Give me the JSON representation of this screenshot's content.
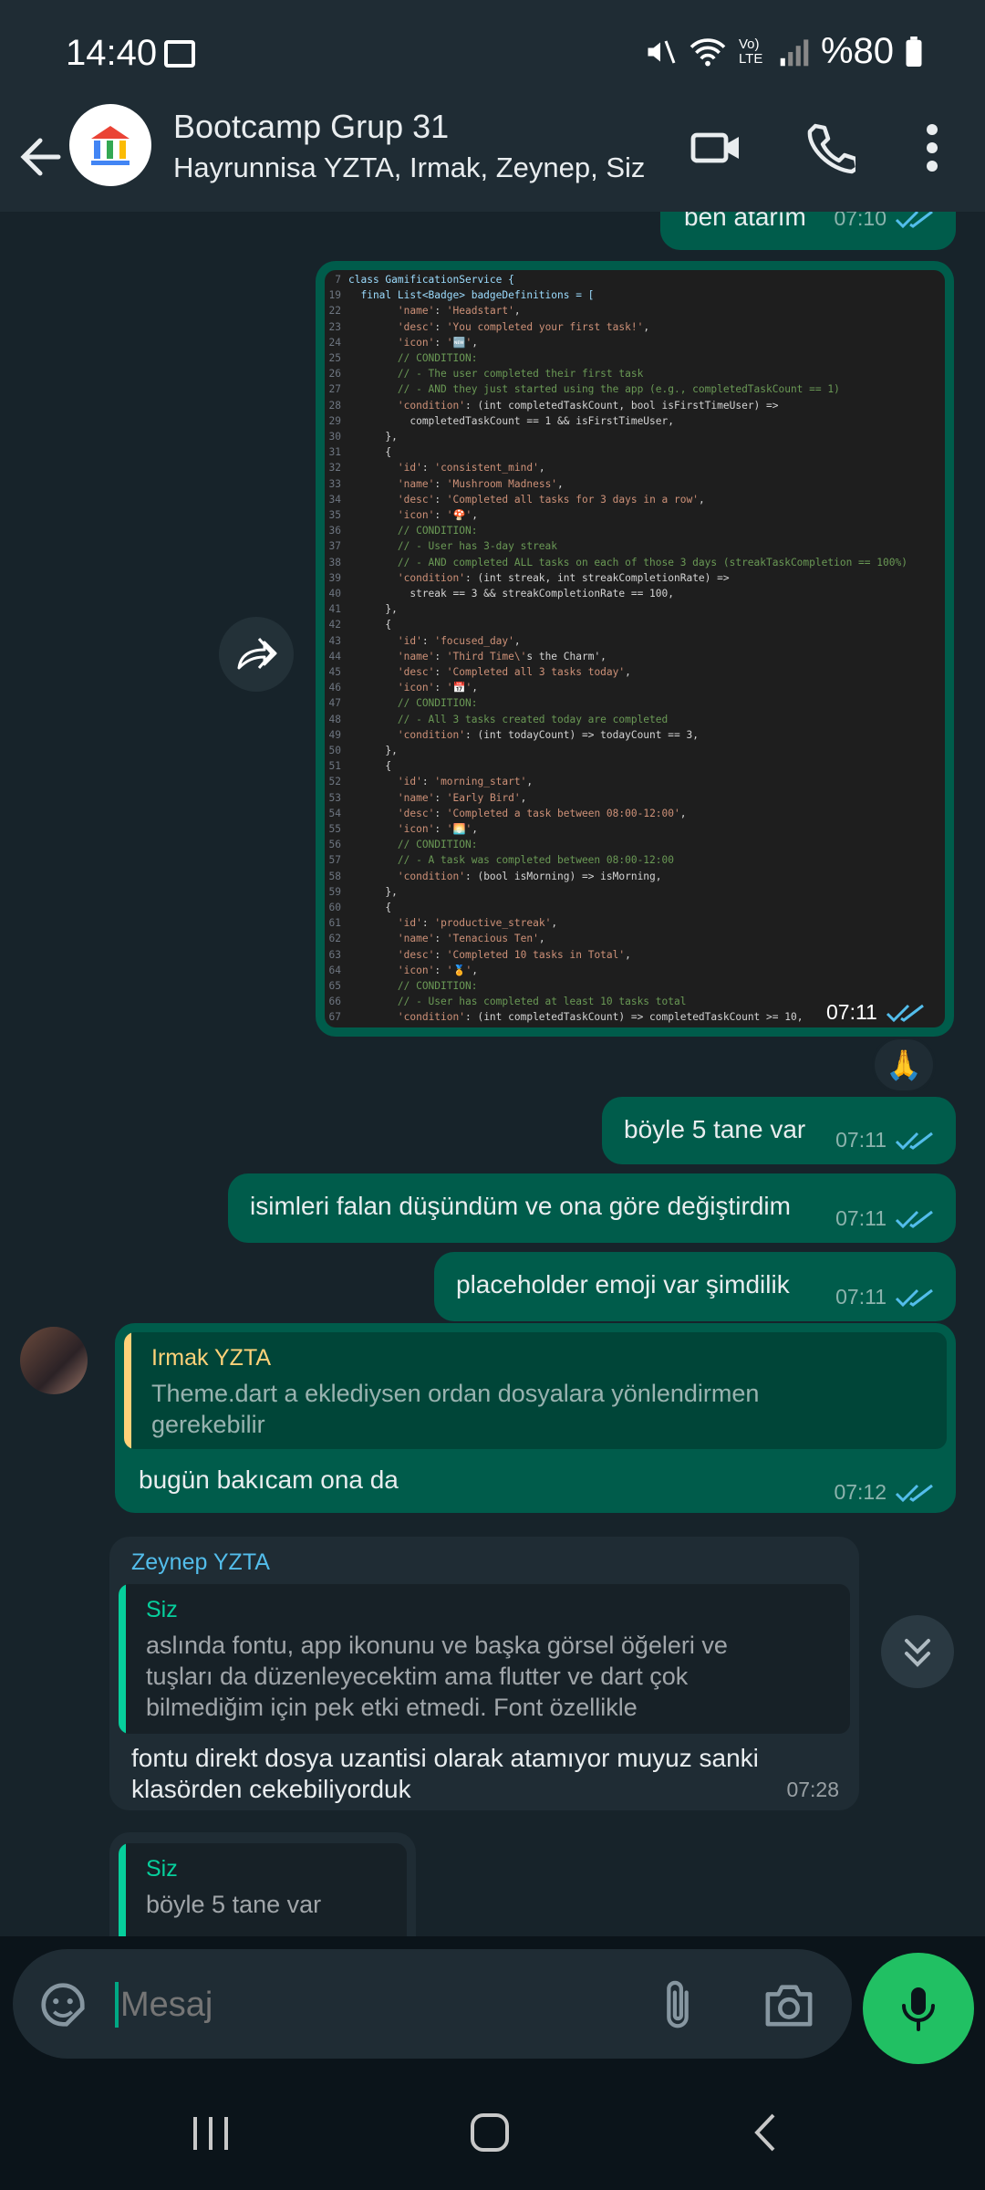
{
  "status_bar": {
    "time": "14:40",
    "battery": "%80",
    "lte_label": "Vo) LTE"
  },
  "header": {
    "title": "Bootcamp Grup 31",
    "subtitle": "Hayrunnisa YZTA, Irmak, Zeynep, Siz",
    "icons": [
      "back-arrow-icon",
      "video-call-icon",
      "phone-icon",
      "more-vertical-icon"
    ]
  },
  "messages": [
    {
      "id": "m1",
      "direction": "out",
      "text": "ben atarım",
      "time": "07:10"
    },
    {
      "id": "m2",
      "direction": "out",
      "type": "image",
      "time": "07:11",
      "reaction": "🙏"
    },
    {
      "id": "m3",
      "direction": "out",
      "text": "böyle 5 tane var",
      "time": "07:11"
    },
    {
      "id": "m4",
      "direction": "out",
      "text": "isimleri falan düşündüm ve ona göre değiştirdim",
      "time": "07:11"
    },
    {
      "id": "m5",
      "direction": "out",
      "text": "placeholder emoji var şimdilik",
      "time": "07:11"
    },
    {
      "id": "m6",
      "direction": "out",
      "time": "07:12",
      "quote": {
        "author": "Irmak YZTA",
        "line1": "Theme.dart a eklediysen ordan dosyalara yönlendirmen",
        "line2": "gerekebilir"
      },
      "text": "bugün bakıcam ona da"
    },
    {
      "id": "m7",
      "direction": "in",
      "sender": "Zeynep YZTA",
      "time": "07:28",
      "quote": {
        "author": "Siz",
        "line1": "aslında fontu, app ikonunu ve başka görsel öğeleri ve",
        "line2": "tuşları da düzenleyecektim ama flutter ve dart çok",
        "line3": "bilmediğim için pek etki etmedi. Font özellikle"
      },
      "line1": "fontu direkt dosya uzantisi olarak atamıyor muyuz sanki",
      "line2": "klasörden cekebiliyorduk"
    },
    {
      "id": "m8",
      "direction": "in",
      "quote": {
        "author": "Siz",
        "line1": "böyle 5 tane var"
      }
    }
  ],
  "code_image": {
    "lines": [
      [
        "7",
        "class GamificationService {"
      ],
      [
        "19",
        "  final List<Badge> badgeDefinitions = ["
      ],
      [
        "22",
        "        'name': 'Headstart',"
      ],
      [
        "23",
        "        'desc': 'You completed your first task!',"
      ],
      [
        "24",
        "        'icon': '🆕',"
      ],
      [
        "25",
        "        // CONDITION:"
      ],
      [
        "26",
        "        // - The user completed their first task"
      ],
      [
        "27",
        "        // - AND they just started using the app (e.g., completedTaskCount == 1)"
      ],
      [
        "28",
        "        'condition': (int completedTaskCount, bool isFirstTimeUser) =>"
      ],
      [
        "29",
        "          completedTaskCount == 1 && isFirstTimeUser,"
      ],
      [
        "30",
        "      },"
      ],
      [
        "31",
        "      {"
      ],
      [
        "32",
        "        'id': 'consistent_mind',"
      ],
      [
        "33",
        "        'name': 'Mushroom Madness',"
      ],
      [
        "34",
        "        'desc': 'Completed all tasks for 3 days in a row',"
      ],
      [
        "35",
        "        'icon': '🍄',"
      ],
      [
        "36",
        "        // CONDITION:"
      ],
      [
        "37",
        "        // - User has 3-day streak"
      ],
      [
        "38",
        "        // - AND completed ALL tasks on each of those 3 days (streakTaskCompletion == 100%)"
      ],
      [
        "39",
        "        'condition': (int streak, int streakCompletionRate) =>"
      ],
      [
        "40",
        "          streak == 3 && streakCompletionRate == 100,"
      ],
      [
        "41",
        "      },"
      ],
      [
        "42",
        "      {"
      ],
      [
        "43",
        "        'id': 'focused_day',"
      ],
      [
        "44",
        "        'name': 'Third Time\\'s the Charm',"
      ],
      [
        "45",
        "        'desc': 'Completed all 3 tasks today',"
      ],
      [
        "46",
        "        'icon': '📅',"
      ],
      [
        "47",
        "        // CONDITION:"
      ],
      [
        "48",
        "        // - All 3 tasks created today are completed"
      ],
      [
        "49",
        "        'condition': (int todayCount) => todayCount == 3,"
      ],
      [
        "50",
        "      },"
      ],
      [
        "51",
        "      {"
      ],
      [
        "52",
        "        'id': 'morning_start',"
      ],
      [
        "53",
        "        'name': 'Early Bird',"
      ],
      [
        "54",
        "        'desc': 'Completed a task between 08:00-12:00',"
      ],
      [
        "55",
        "        'icon': '🌅',"
      ],
      [
        "56",
        "        // CONDITION:"
      ],
      [
        "57",
        "        // - A task was completed between 08:00-12:00"
      ],
      [
        "58",
        "        'condition': (bool isMorning) => isMorning,"
      ],
      [
        "59",
        "      },"
      ],
      [
        "60",
        "      {"
      ],
      [
        "61",
        "        'id': 'productive_streak',"
      ],
      [
        "62",
        "        'name': 'Tenacious Ten',"
      ],
      [
        "63",
        "        'desc': 'Completed 10 tasks in Total',"
      ],
      [
        "64",
        "        'icon': '🏅',"
      ],
      [
        "65",
        "        // CONDITION:"
      ],
      [
        "66",
        "        // - User has completed at least 10 tasks total"
      ],
      [
        "67",
        "        'condition': (int completedTaskCount) => completedTaskCount >= 10,"
      ]
    ]
  },
  "input": {
    "placeholder": "Mesaj",
    "icons": [
      "sticker-icon",
      "attach-icon",
      "camera-icon",
      "mic-icon"
    ]
  },
  "colors": {
    "outgoing_bubble": "#005c4b",
    "incoming_bubble": "#1f2c34",
    "accent_green": "#21c063",
    "read_ticks": "#53bdeb",
    "quote_irmak": "#ffd279",
    "quote_siz": "#06cf9c",
    "zeynep_name": "#53bdeb"
  }
}
